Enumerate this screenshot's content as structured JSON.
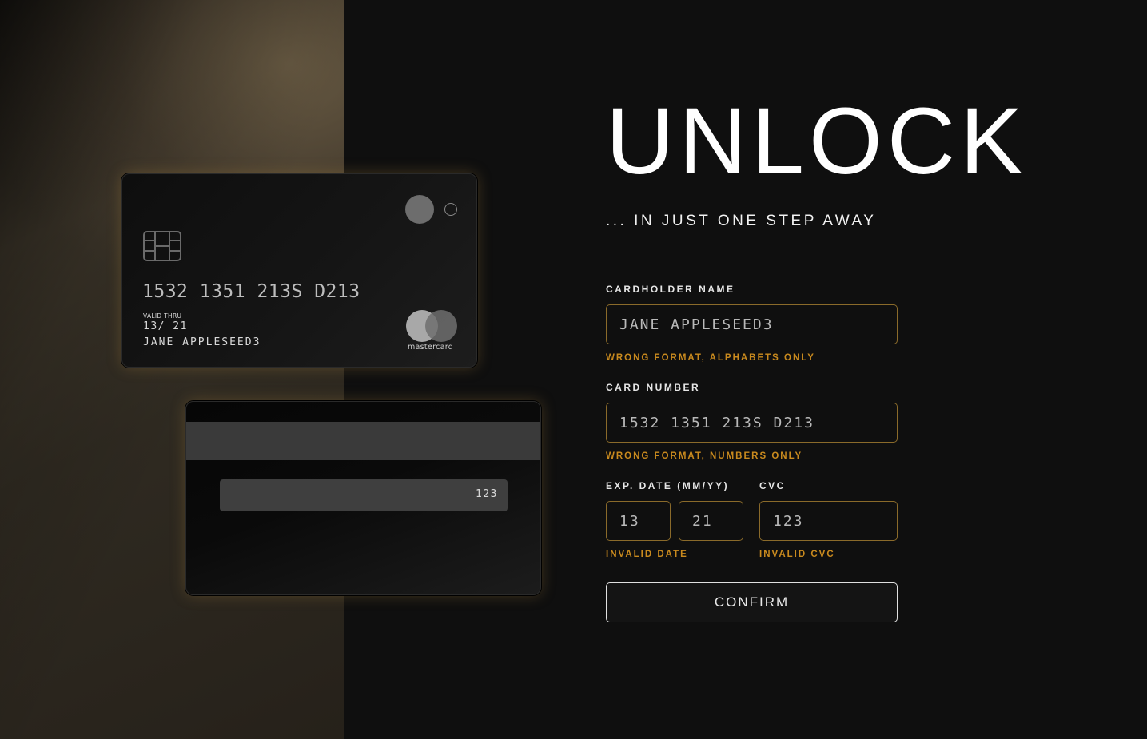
{
  "card_front": {
    "number": "1532 1351 213S D213",
    "valid_thru_label": "VALID THRU",
    "valid_thru_value": "13/ 21",
    "holder": "JANE APPLESEED3",
    "brand": "mastercard"
  },
  "card_back": {
    "cvc": "123"
  },
  "header": {
    "title": "UNLOCK",
    "subtitle": "... IN JUST ONE STEP AWAY"
  },
  "form": {
    "cardholder_label": "CARDHOLDER NAME",
    "cardholder_value": "JANE APPLESEED3",
    "cardholder_error": "WRONG FORMAT, ALPHABETS ONLY",
    "number_label": "CARD NUMBER",
    "number_value": "1532 1351 213S D213",
    "number_error": "WRONG FORMAT, NUMBERS ONLY",
    "exp_label": "EXP. DATE (MM/YY)",
    "exp_month": "13",
    "exp_year": "21",
    "exp_error": "INVALID DATE",
    "cvc_label": "CVC",
    "cvc_value": "123",
    "cvc_error": "INVALID CVC",
    "confirm_label": "CONFIRM"
  },
  "colors": {
    "accent": "#c98a1e",
    "input_border": "#8a6a2a",
    "background": "#0f0f0f"
  }
}
